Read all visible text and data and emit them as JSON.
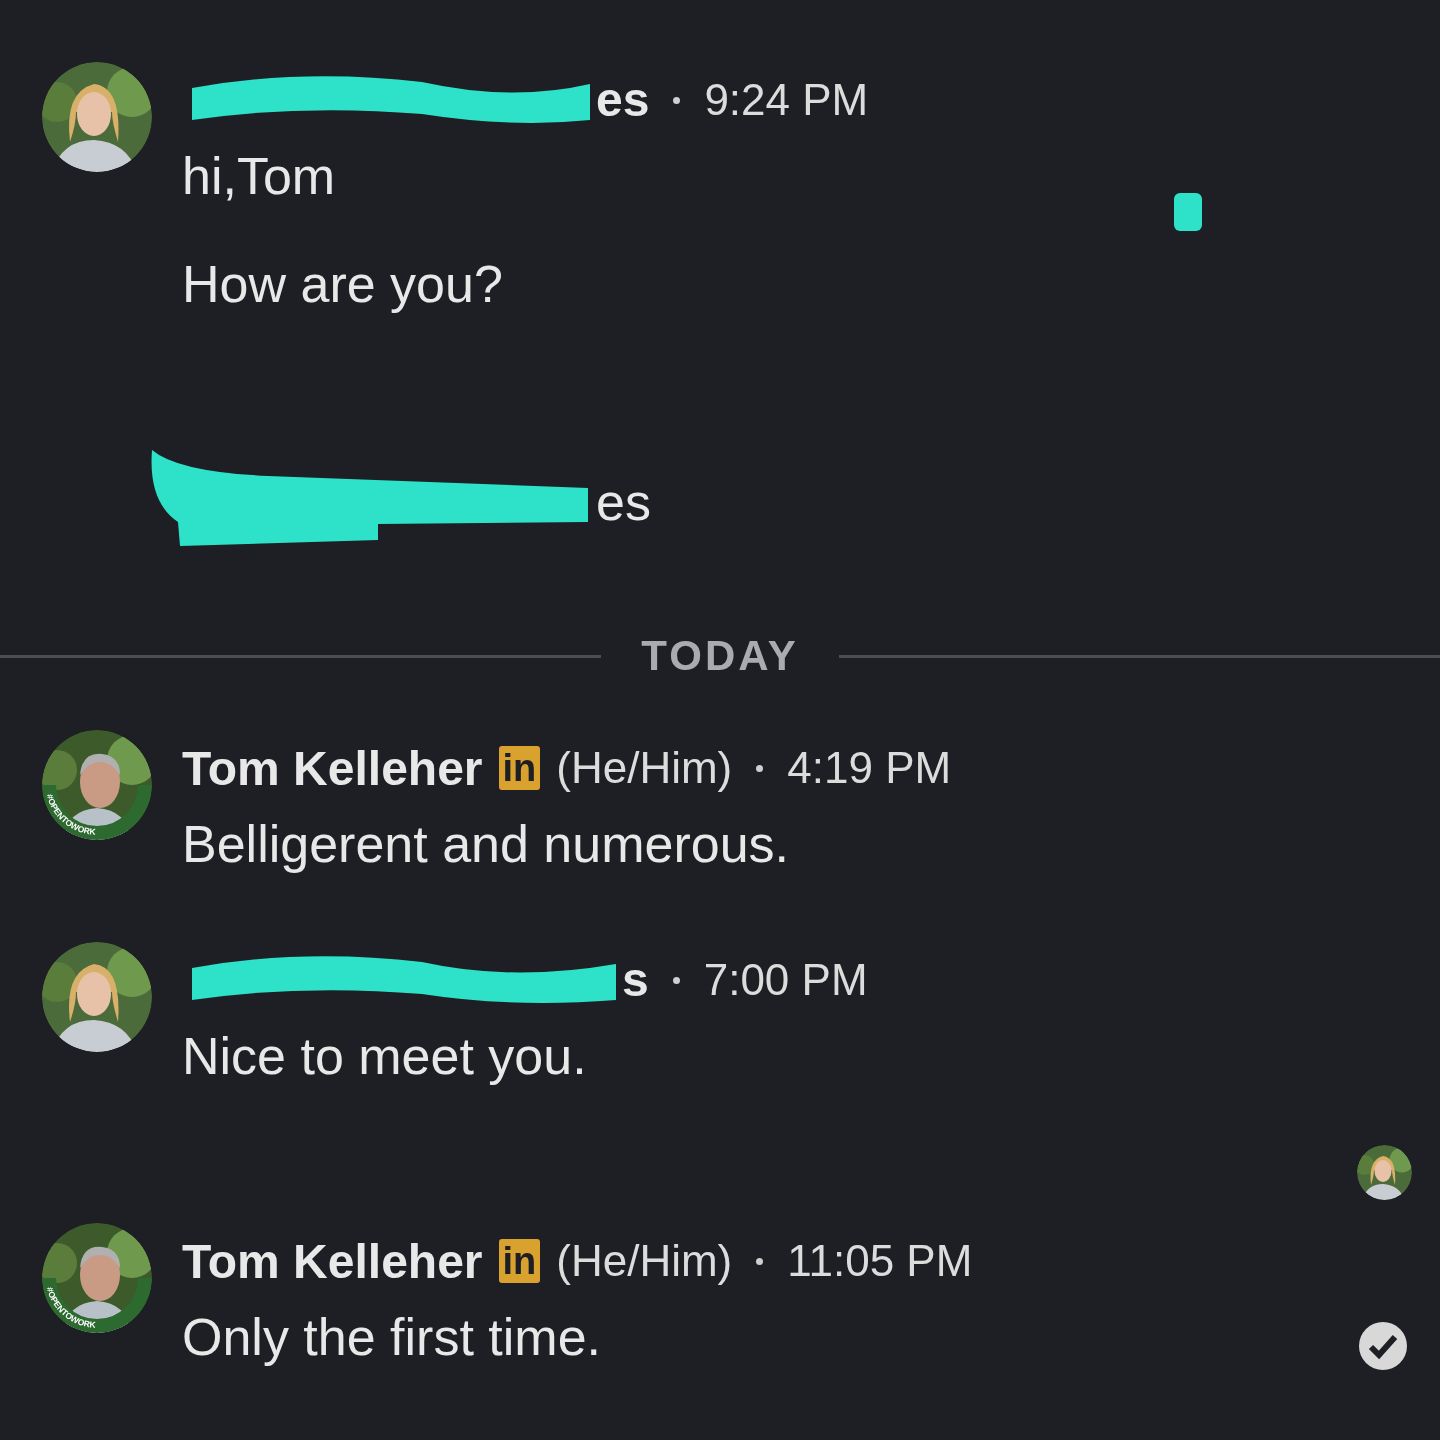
{
  "conversation": [
    {
      "kind": "message",
      "avatar": {
        "kind": "picture"
      },
      "sender": {
        "name": "es",
        "redacted": true
      },
      "time": "9:24 PM",
      "texts": [
        "hi,Tom",
        "How are you?"
      ],
      "redaction_mark": true,
      "delivered": false
    },
    {
      "kind": "shared",
      "name": "es",
      "redacted": true
    },
    {
      "kind": "divider",
      "label": "TODAY"
    },
    {
      "kind": "message",
      "avatar": {
        "kind": "picture",
        "open_to_work": "#OPENTOWORK"
      },
      "sender": {
        "name": "Tom Kelleher",
        "redacted": false,
        "badge": "in",
        "pronouns": "(He/Him)"
      },
      "time": "4:19 PM",
      "texts": [
        "Belligerent and numerous."
      ],
      "redaction_mark": false,
      "delivered": false
    },
    {
      "kind": "message",
      "avatar": {
        "kind": "picture"
      },
      "sender": {
        "name": "s",
        "redacted": true
      },
      "time": "7:00 PM",
      "texts": [
        "Nice to meet you."
      ],
      "redaction_mark": false,
      "delivered": false
    },
    {
      "kind": "read_receipt",
      "avatar": {
        "kind": "picture"
      }
    },
    {
      "kind": "message",
      "avatar": {
        "kind": "picture",
        "open_to_work": "#OPENTOWORK"
      },
      "sender": {
        "name": "Tom Kelleher",
        "redacted": false,
        "badge": "in",
        "pronouns": "(He/Him)"
      },
      "time": "11:05 PM",
      "texts": [
        "Only the first time."
      ],
      "redaction_mark": false,
      "delivered": true
    }
  ]
}
